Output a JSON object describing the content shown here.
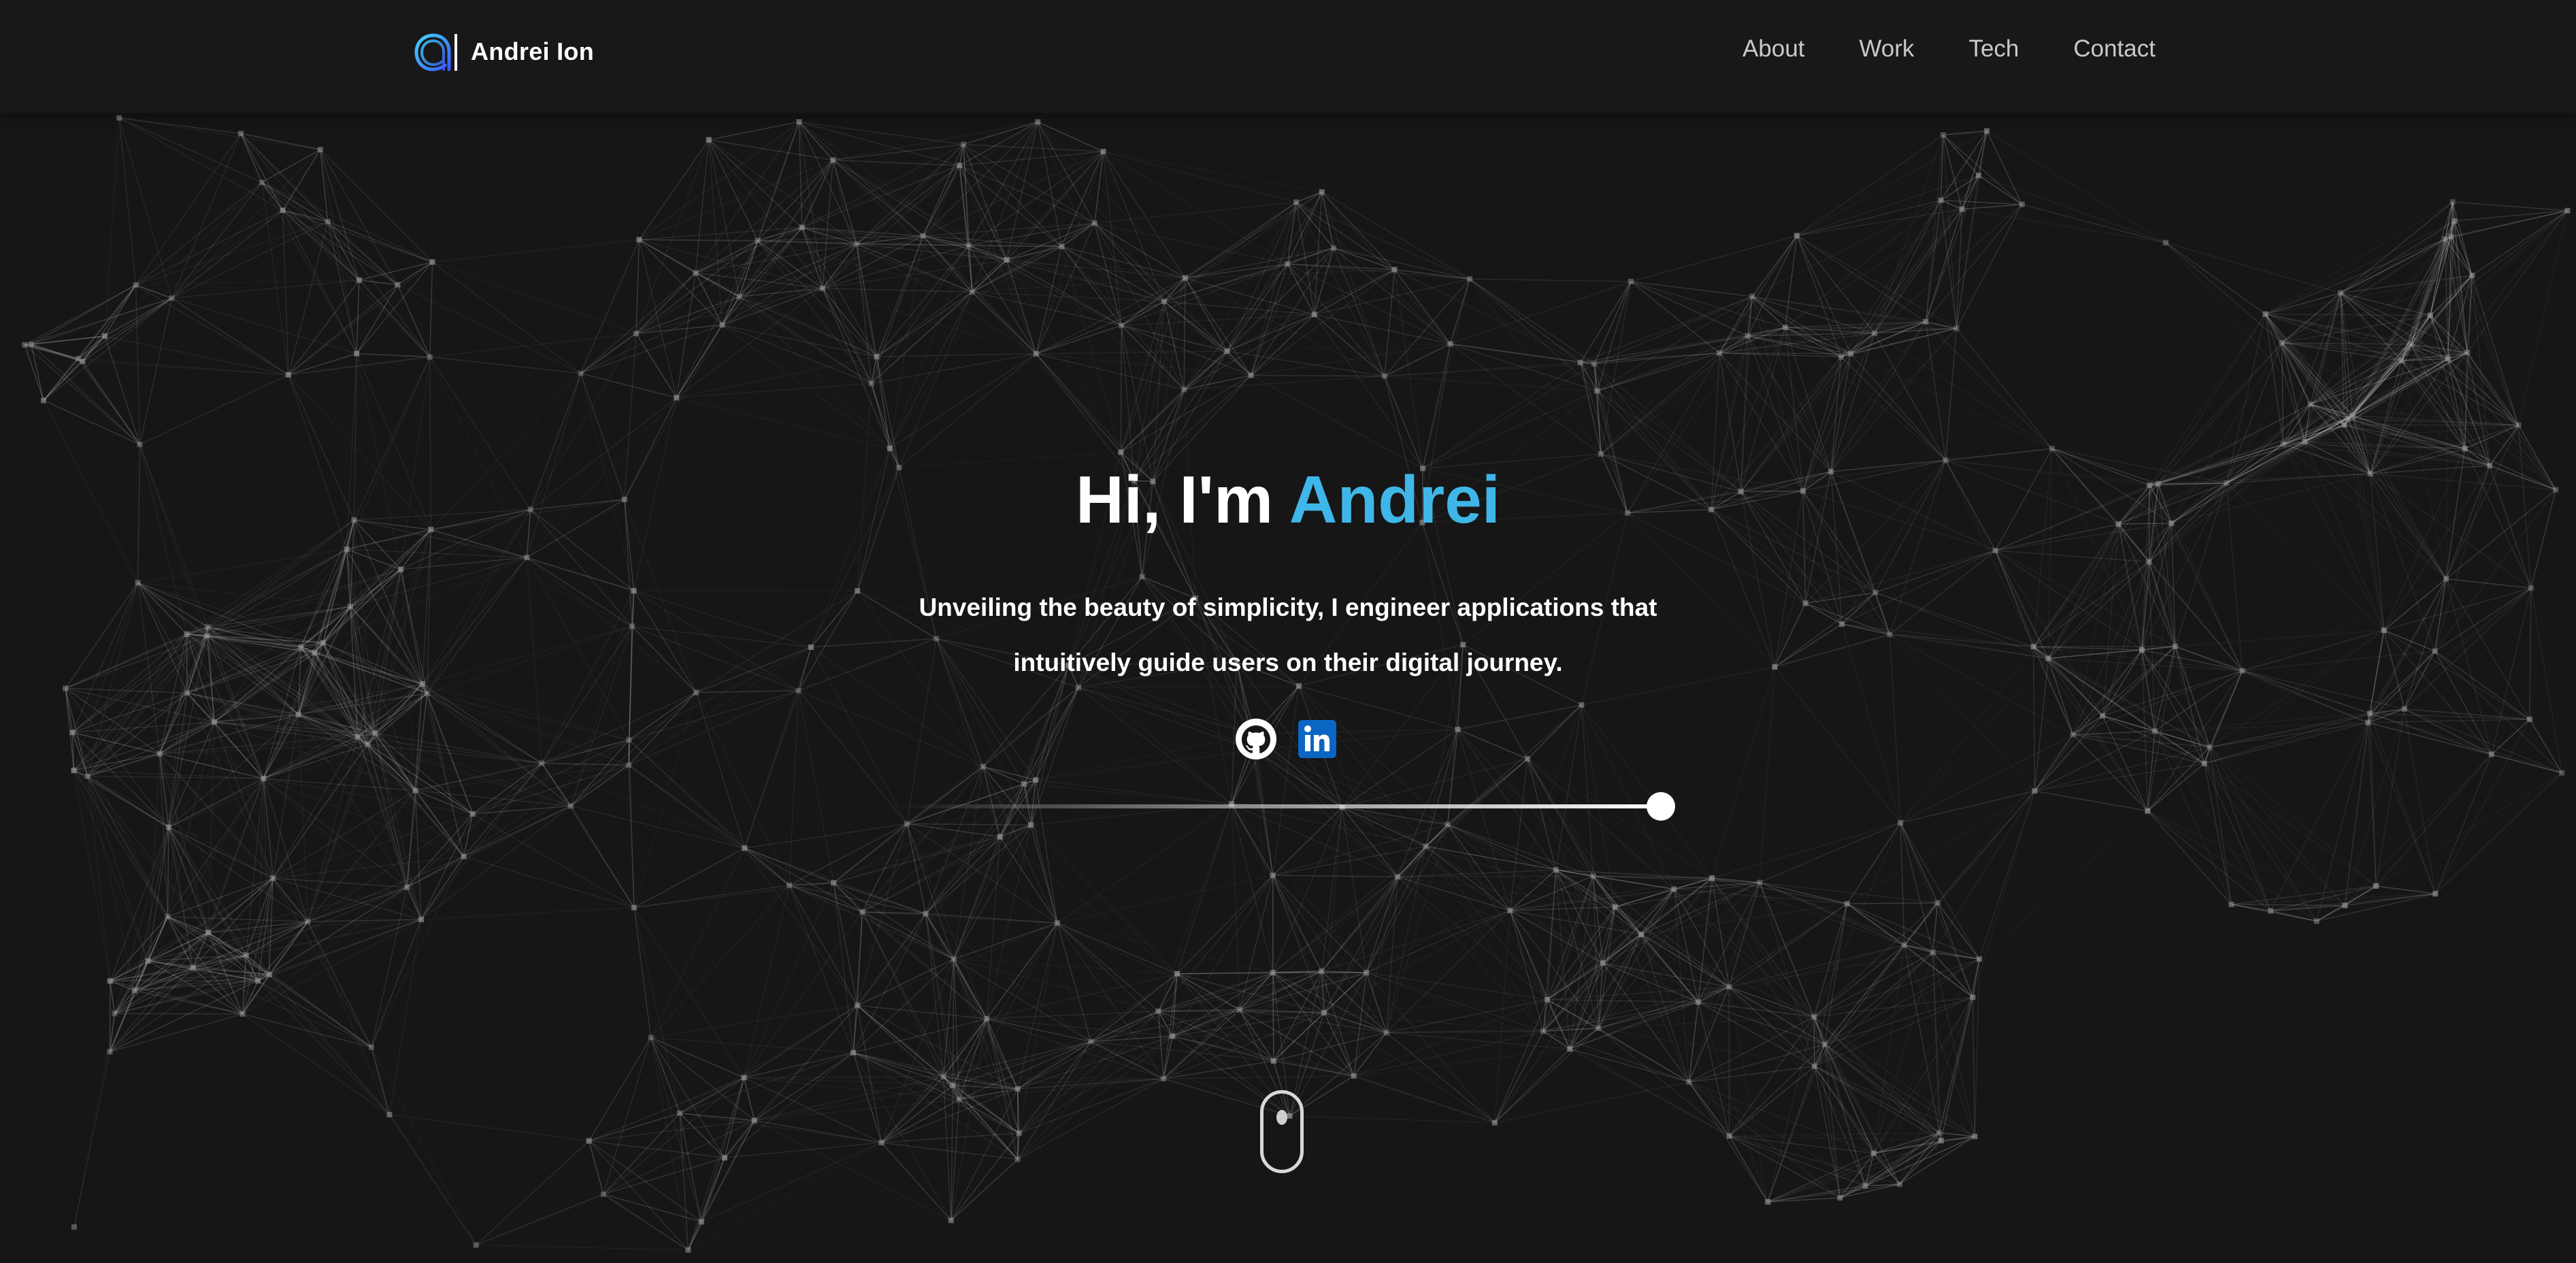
{
  "header": {
    "brand_name": "Andrei Ion",
    "nav": [
      {
        "label": "About"
      },
      {
        "label": "Work"
      },
      {
        "label": "Tech"
      },
      {
        "label": "Contact"
      }
    ]
  },
  "hero": {
    "title_prefix": "Hi, I'm ",
    "title_name": "Andrei",
    "subtitle_line1": "Unveiling the beauty of simplicity, I engineer applications that",
    "subtitle_line2": "intuitively guide users on their digital journey.",
    "social": [
      {
        "icon": "github-icon"
      },
      {
        "icon": "linkedin-icon"
      }
    ]
  },
  "scroll_indicator": {
    "icon": "mouse-scroll-icon"
  },
  "background": {
    "type": "particle-network"
  },
  "colors": {
    "background": "#161616",
    "accent": "#3fb6e8",
    "text": "#ffffff",
    "nav_text": "#c9c9c9",
    "linkedin": "#0a66c2"
  }
}
